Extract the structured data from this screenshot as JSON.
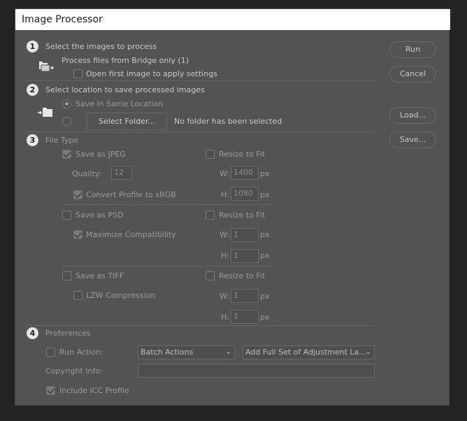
{
  "window": {
    "title": "Image Processor"
  },
  "steps": [
    "1",
    "2",
    "3",
    "4"
  ],
  "section1": {
    "heading": "Select the images to process",
    "source_text": "Process files from Bridge only (1)",
    "open_first_label": "Open first image to apply settings"
  },
  "section2": {
    "heading": "Select location to save processed images",
    "same_location_label": "Save in Same Location",
    "select_folder_label": "Select Folder...",
    "folder_status": "No folder has been selected"
  },
  "section3": {
    "heading": "File Type",
    "jpeg": {
      "save_label": "Save as JPEG",
      "resize_label": "Resize to Fit",
      "quality_label": "Quality:",
      "quality_value": "12",
      "w_label": "W:",
      "w_value": "1400",
      "h_label": "H:",
      "h_value": "1080",
      "unit": "px",
      "convert_label": "Convert Profile to sRGB"
    },
    "psd": {
      "save_label": "Save as PSD",
      "resize_label": "Resize to Fit",
      "maximize_label": "Maximize Compatibility",
      "w_label": "W:",
      "w_value": "1",
      "h_label": "H:",
      "h_value": "1",
      "unit": "px"
    },
    "tiff": {
      "save_label": "Save as TIFF",
      "resize_label": "Resize to Fit",
      "lzw_label": "LZW Compression",
      "w_label": "W:",
      "w_value": "1",
      "h_label": "H:",
      "h_value": "1",
      "unit": "px"
    }
  },
  "section4": {
    "heading": "Preferences",
    "run_action_label": "Run Action:",
    "action_set": "Batch Actions",
    "action_name": "Add Full Set of Adjustment La...",
    "copyright_label": "Copyright Info:",
    "copyright_value": "",
    "icc_label": "Include ICC Profile"
  },
  "buttons": {
    "run": "Run",
    "cancel": "Cancel",
    "load": "Load...",
    "save": "Save..."
  }
}
